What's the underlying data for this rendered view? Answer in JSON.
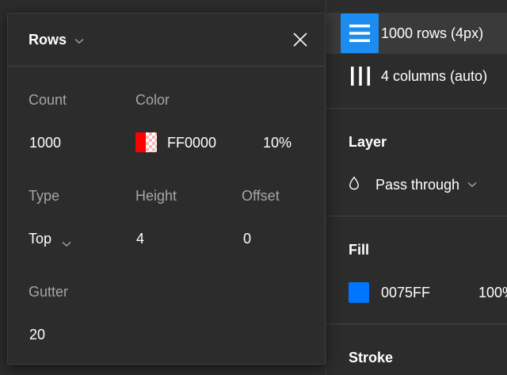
{
  "layout_grids": {
    "items": [
      {
        "label": "1000 rows (4px)",
        "icon": "rows-icon",
        "selected": true
      },
      {
        "label": "4 columns (auto)",
        "icon": "columns-icon",
        "selected": false
      }
    ]
  },
  "layer": {
    "title": "Layer",
    "blend_mode": "Pass through",
    "icon": "drop-icon"
  },
  "fill": {
    "title": "Fill",
    "hex": "0075FF",
    "opacity": "100%",
    "swatch_color": "#0075ff"
  },
  "stroke": {
    "title": "Stroke"
  },
  "rows_popover": {
    "title": "Rows",
    "count_label": "Count",
    "count_value": "1000",
    "color_label": "Color",
    "color_hex": "FF0000",
    "color_opacity": "10%",
    "color_swatch": "#ff0000",
    "type_label": "Type",
    "type_value": "Top",
    "height_label": "Height",
    "height_value": "4",
    "offset_label": "Offset",
    "offset_value": "0",
    "gutter_label": "Gutter",
    "gutter_value": "20"
  },
  "colors": {
    "panel_bg": "#2c2c2c",
    "selected_row_bg": "#3a3a3a",
    "accent": "#1d8cf0",
    "label_gray": "#a6a6a6"
  }
}
